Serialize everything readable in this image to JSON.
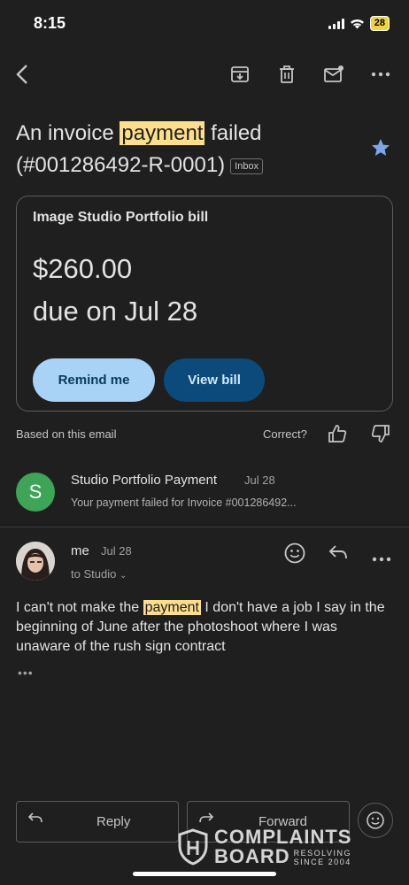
{
  "status_bar": {
    "time": "8:15",
    "battery": "28"
  },
  "toolbar": {
    "back_icon": "back-arrow-icon",
    "archive_icon": "archive-icon",
    "delete_icon": "trash-icon",
    "mark_unread_icon": "mail-unread-icon",
    "more_icon": "more-icon"
  },
  "email": {
    "subject_before": "An invoice ",
    "subject_highlight": "payment",
    "subject_after": " failed",
    "subject_line2": "(#001286492-R-0001)",
    "label": "Inbox"
  },
  "bill_card": {
    "title": "Image Studio Portfolio bill",
    "amount": "$260.00",
    "due": "due on Jul 28",
    "remind_label": "Remind me",
    "view_label": "View bill"
  },
  "feedback": {
    "based": "Based on this email",
    "correct": "Correct?"
  },
  "message1": {
    "avatar_letter": "S",
    "sender": "Studio Portfolio Payment",
    "date": "Jul 28",
    "snippet": "Your payment failed for Invoice #001286492..."
  },
  "message2": {
    "sender": "me",
    "date": "Jul 28",
    "to": "to Studio",
    "body_before": "I can't not make the ",
    "body_highlight": "payment",
    "body_after": " I don't have a job I say in the beginning of June after the photoshoot where I was unaware of the rush sign contract",
    "ellipsis": "•••"
  },
  "actions": {
    "reply": "Reply",
    "forward": "Forward"
  },
  "watermark": {
    "line1": "COMPLAINTS",
    "line2": "BOARD",
    "small1": "RESOLVING",
    "small2": "SINCE 2004"
  },
  "colors": {
    "background": "#1f1f1f",
    "highlight": "#fddf8b",
    "remind_button": "#a8d3f7",
    "view_button": "#0b4a7a",
    "star": "#7aa7e8",
    "avatar_s": "#3ea456"
  }
}
